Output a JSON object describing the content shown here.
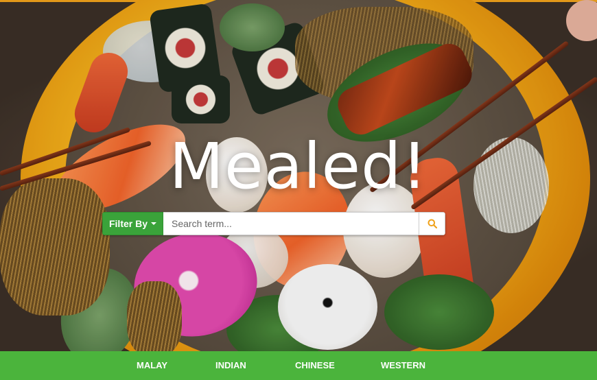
{
  "app": {
    "brand": "Mealed!"
  },
  "search": {
    "filter_label": "Filter By",
    "placeholder": "Search term...",
    "value": ""
  },
  "nav": {
    "items": [
      {
        "label": "MALAY"
      },
      {
        "label": "INDIAN"
      },
      {
        "label": "CHINESE"
      },
      {
        "label": "WESTERN"
      }
    ]
  },
  "colors": {
    "accent_green": "#4bb43c",
    "button_green": "#3aa33a",
    "search_icon": "#f0a21b"
  },
  "icons": {
    "filter_caret": "caret-down-icon",
    "search": "search-icon"
  }
}
